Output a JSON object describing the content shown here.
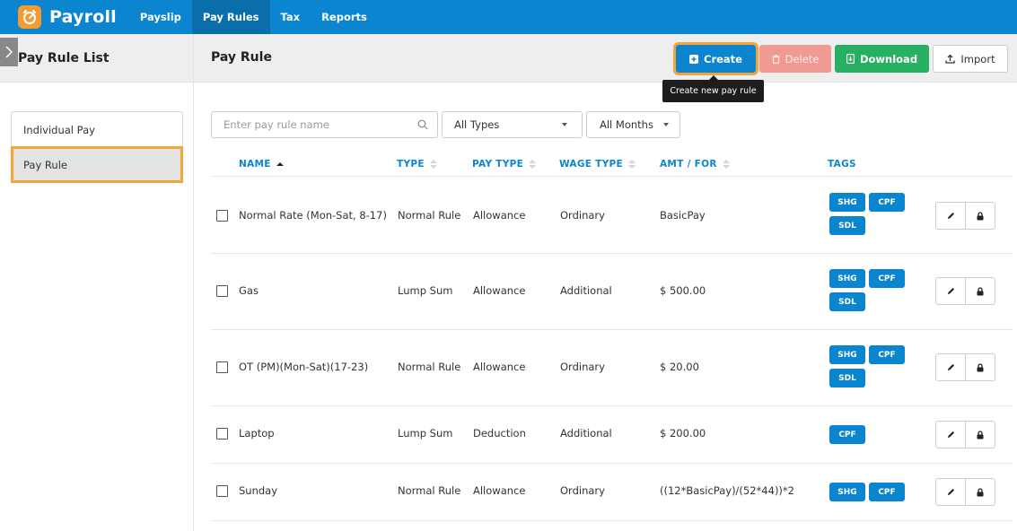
{
  "app": {
    "name": "Payroll"
  },
  "nav": [
    "Payslip",
    "Pay Rules",
    "Tax",
    "Reports"
  ],
  "left_panel": {
    "title": "Pay Rule List",
    "items": [
      "Individual Pay",
      "Pay Rule"
    ]
  },
  "main": {
    "title": "Pay Rule",
    "buttons": {
      "create": "Create",
      "delete": "Delete",
      "download": "Download",
      "import": "Import"
    },
    "tooltip": "Create new pay rule"
  },
  "filters": {
    "search_placeholder": "Enter pay rule name",
    "type": "All Types",
    "month": "All Months"
  },
  "table": {
    "headers": {
      "name": "NAME",
      "type": "TYPE",
      "pay_type": "PAY TYPE",
      "wage_type": "WAGE TYPE",
      "amt": "AMT / FOR",
      "tags": "TAGS"
    },
    "rows": [
      {
        "name": "Normal Rate (Mon-Sat, 8-17)",
        "type": "Normal Rule",
        "pay_type": "Allowance",
        "wage_type": "Ordinary",
        "amt": "BasicPay",
        "tags": [
          "SHG",
          "CPF",
          "SDL"
        ]
      },
      {
        "name": "Gas",
        "type": "Lump Sum",
        "pay_type": "Allowance",
        "wage_type": "Additional",
        "amt": "$ 500.00",
        "tags": [
          "SHG",
          "CPF",
          "SDL"
        ]
      },
      {
        "name": "OT (PM)(Mon-Sat)(17-23)",
        "type": "Normal Rule",
        "pay_type": "Allowance",
        "wage_type": "Ordinary",
        "amt": "$ 20.00",
        "tags": [
          "SHG",
          "CPF",
          "SDL"
        ]
      },
      {
        "name": "Laptop",
        "type": "Lump Sum",
        "pay_type": "Deduction",
        "wage_type": "Additional",
        "amt": "$ 200.00",
        "tags": [
          "CPF"
        ]
      },
      {
        "name": "Sunday",
        "type": "Normal Rule",
        "pay_type": "Allowance",
        "wage_type": "Ordinary",
        "amt": "((12*BasicPay)/(52*44))*2",
        "tags": [
          "SHG",
          "CPF"
        ]
      }
    ]
  },
  "colors": {
    "topbar": "#0b85cf",
    "accent_outline": "#f5a43a",
    "download": "#27b062",
    "delete": "#ef9b93",
    "logo": "#f39c33"
  },
  "icons": [
    "logo-timer-icon",
    "chevron-right-icon",
    "plus-square-icon",
    "trash-icon",
    "file-download-icon",
    "upload-icon",
    "search-icon",
    "caret-down-icon",
    "pencil-icon",
    "lock-icon"
  ]
}
